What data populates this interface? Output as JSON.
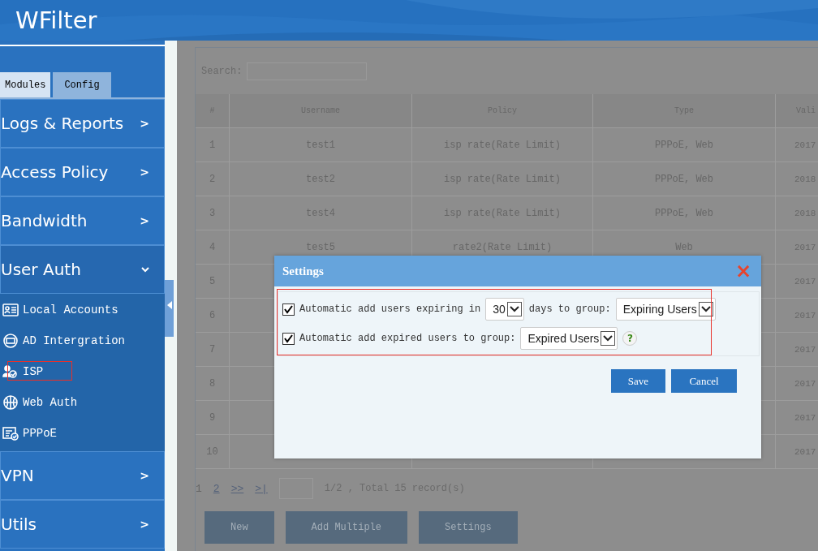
{
  "header": {
    "title": "WFilter"
  },
  "sidebar": {
    "tabs": [
      {
        "label": "Modules",
        "selected": true
      },
      {
        "label": "Config",
        "selected": false
      }
    ],
    "items": [
      {
        "label": "Logs & Reports",
        "expanded": false,
        "arrow": ">"
      },
      {
        "label": "Access Policy",
        "expanded": false,
        "arrow": ">"
      },
      {
        "label": "Bandwidth",
        "expanded": false,
        "arrow": ">"
      },
      {
        "label": "User Auth",
        "expanded": true,
        "children": [
          {
            "label": "Local Accounts",
            "highlighted": false
          },
          {
            "label": "AD Intergration",
            "highlighted": false
          },
          {
            "label": "ISP",
            "highlighted": true
          },
          {
            "label": "Web Auth",
            "highlighted": false
          },
          {
            "label": "PPPoE",
            "highlighted": false
          }
        ]
      },
      {
        "label": "VPN",
        "expanded": false,
        "arrow": ">"
      },
      {
        "label": "Utils",
        "expanded": false,
        "arrow": ">"
      }
    ]
  },
  "main": {
    "search": {
      "label": "Search:"
    },
    "table": {
      "columns": [
        "#",
        "Username",
        "Policy",
        "Type",
        "Vali"
      ],
      "rows": [
        [
          "1",
          "test1",
          "isp rate(Rate Limit)",
          "PPPoE, Web",
          "2017"
        ],
        [
          "2",
          "test2",
          "isp rate(Rate Limit)",
          "PPPoE, Web",
          "2018"
        ],
        [
          "3",
          "test4",
          "isp rate(Rate Limit)",
          "PPPoE, Web",
          "2018"
        ],
        [
          "4",
          "test5",
          "rate2(Rate Limit)",
          "Web",
          "2017"
        ],
        [
          "5",
          "",
          "",
          "",
          "2017"
        ],
        [
          "6",
          "",
          "",
          "",
          "2017"
        ],
        [
          "7",
          "",
          "",
          "",
          "2017"
        ],
        [
          "8",
          "",
          "",
          "",
          "2017"
        ],
        [
          "9",
          "",
          "",
          "",
          "2017"
        ],
        [
          "10",
          "",
          "",
          "",
          "2017"
        ]
      ]
    },
    "pagination": {
      "pages": [
        {
          "label": "1",
          "selected": true
        },
        {
          "label": "2",
          "selected": false
        },
        {
          "label": ">>",
          "selected": false
        },
        {
          "label": ">|",
          "selected": false
        }
      ],
      "summary": "1/2 , Total 15 record(s)"
    },
    "buttons": [
      "New",
      "Add Multiple",
      "Settings"
    ]
  },
  "dialog": {
    "title": "Settings",
    "close": "×",
    "highlighted": true,
    "rows": [
      {
        "checked": true,
        "parts": [
          {
            "kind": "text",
            "text": "Automatic add users expiring in"
          },
          {
            "kind": "select",
            "value": "30"
          },
          {
            "kind": "text",
            "text": "days to group:"
          },
          {
            "kind": "select",
            "value": "Expiring Users"
          }
        ]
      },
      {
        "checked": true,
        "parts": [
          {
            "kind": "text",
            "text": "Automatic add expired users to group:"
          },
          {
            "kind": "select",
            "value": "Expired Users"
          },
          {
            "kind": "help",
            "text": "?"
          }
        ]
      }
    ],
    "buttons": [
      "Save",
      "Cancel"
    ]
  }
}
